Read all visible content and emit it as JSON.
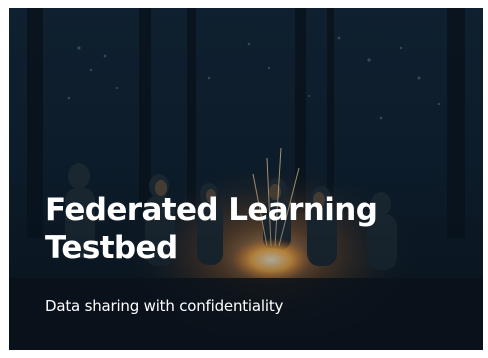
{
  "card": {
    "title": "Federated Learning Testbed",
    "subtitle": "Data sharing with confidentiality",
    "image": "campfire-night-forest-photo"
  },
  "colors": {
    "background_dark": "#0c1a26",
    "text": "#ffffff",
    "fire": "#ffb347"
  }
}
